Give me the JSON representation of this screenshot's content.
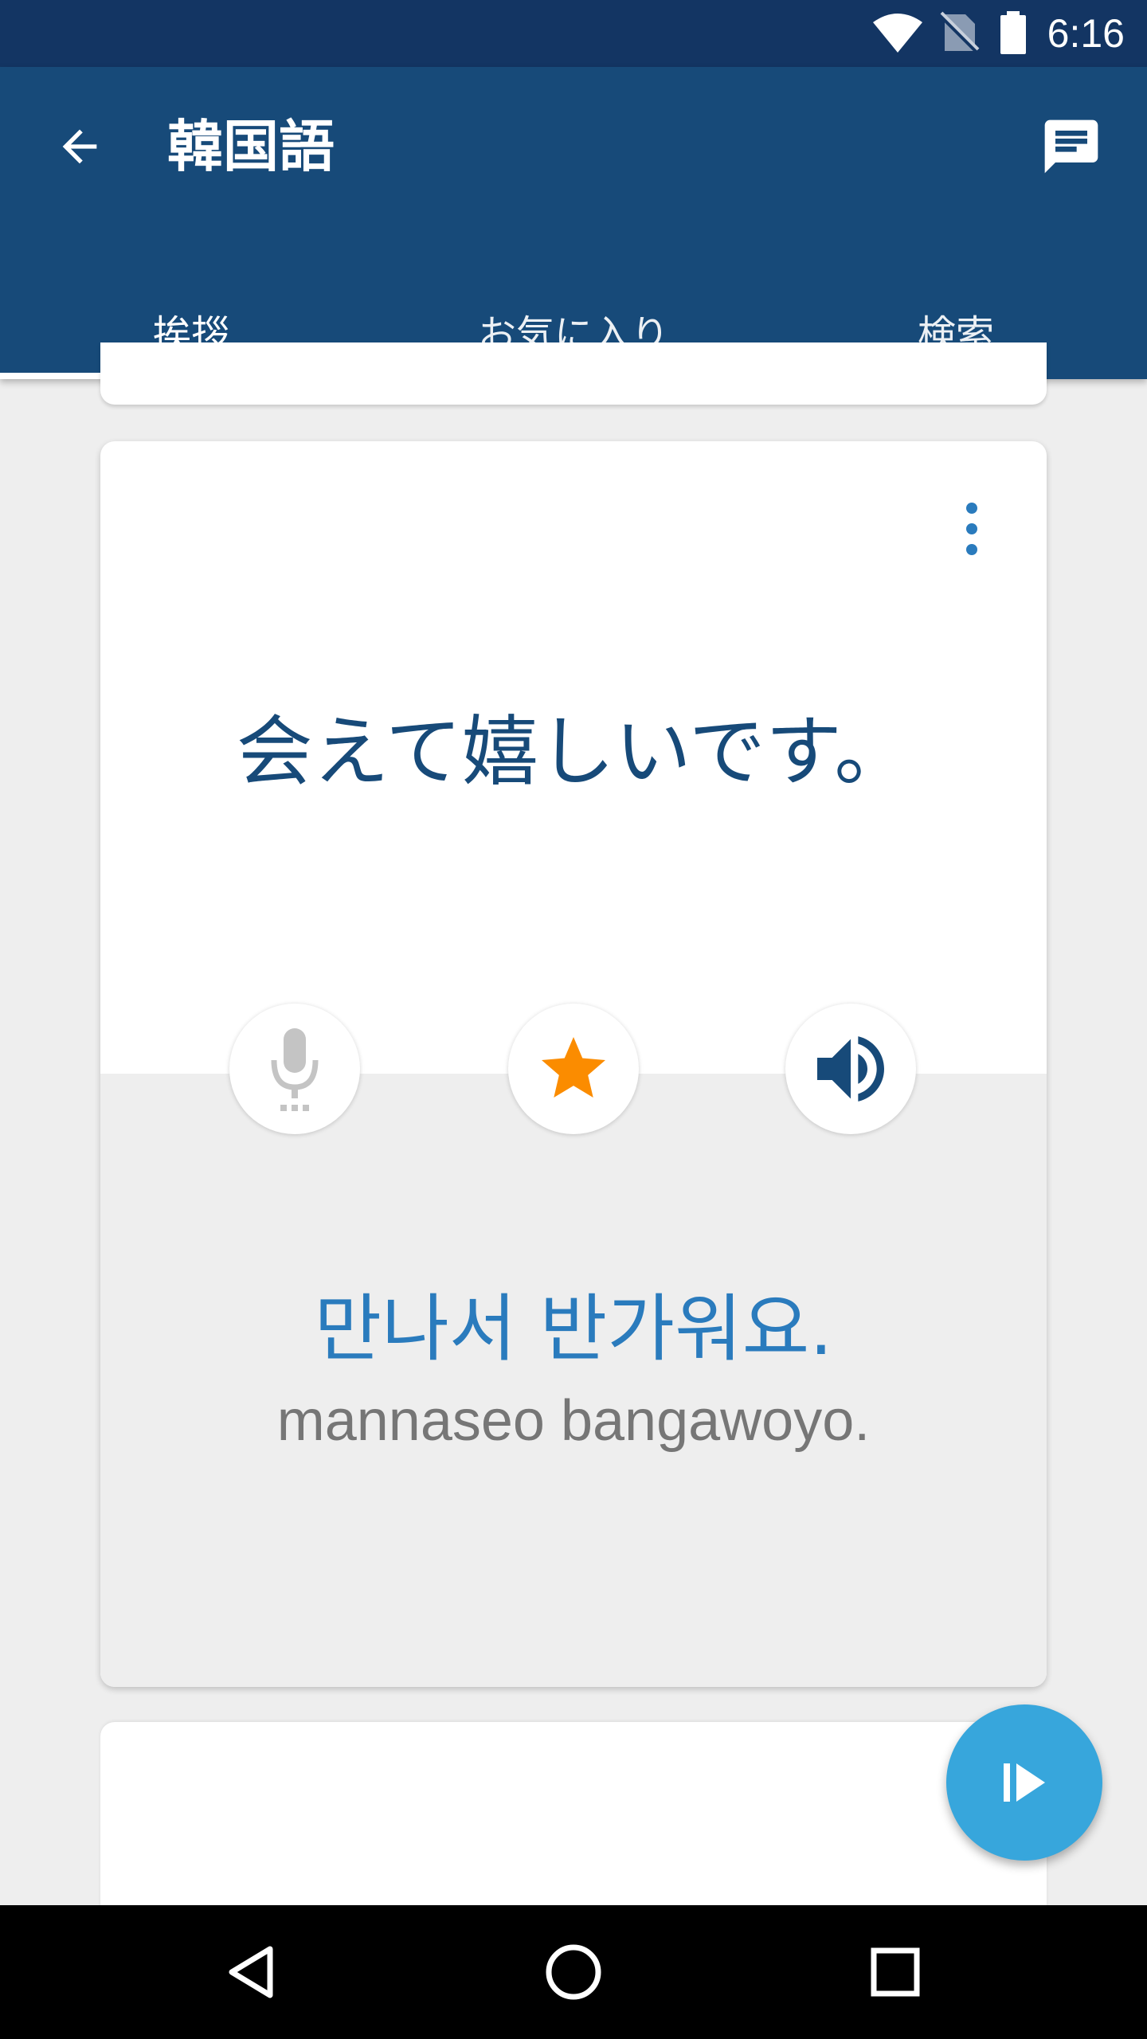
{
  "status_bar": {
    "time": "6:16",
    "icons": [
      "wifi-icon",
      "no-sim-icon",
      "battery-icon"
    ]
  },
  "app_bar": {
    "title": "韓国語",
    "back_icon": "arrow-back-icon",
    "action_icon": "chat-icon"
  },
  "tabs": [
    {
      "label": "挨拶",
      "active": true
    },
    {
      "label": "お気に入り",
      "active": false
    },
    {
      "label": "検索",
      "active": false
    }
  ],
  "card": {
    "native_phrase": "会えて嬉しいです。",
    "translation": "만나서 반가워요.",
    "romanization": "mannaseo bangawoyo.",
    "buttons": [
      "microphone-icon",
      "star-icon",
      "speaker-icon"
    ],
    "favorite": true
  },
  "fab": {
    "icon": "play-icon"
  },
  "nav_bar": {
    "icons": [
      "back-triangle-icon",
      "home-circle-icon",
      "recents-square-icon"
    ]
  },
  "colors": {
    "status_bar": "#133563",
    "app_bar": "#174a79",
    "native_text": "#174a79",
    "translation_text": "#2a7bbd",
    "star": "#fb8c00",
    "fab": "#37a6dc"
  }
}
